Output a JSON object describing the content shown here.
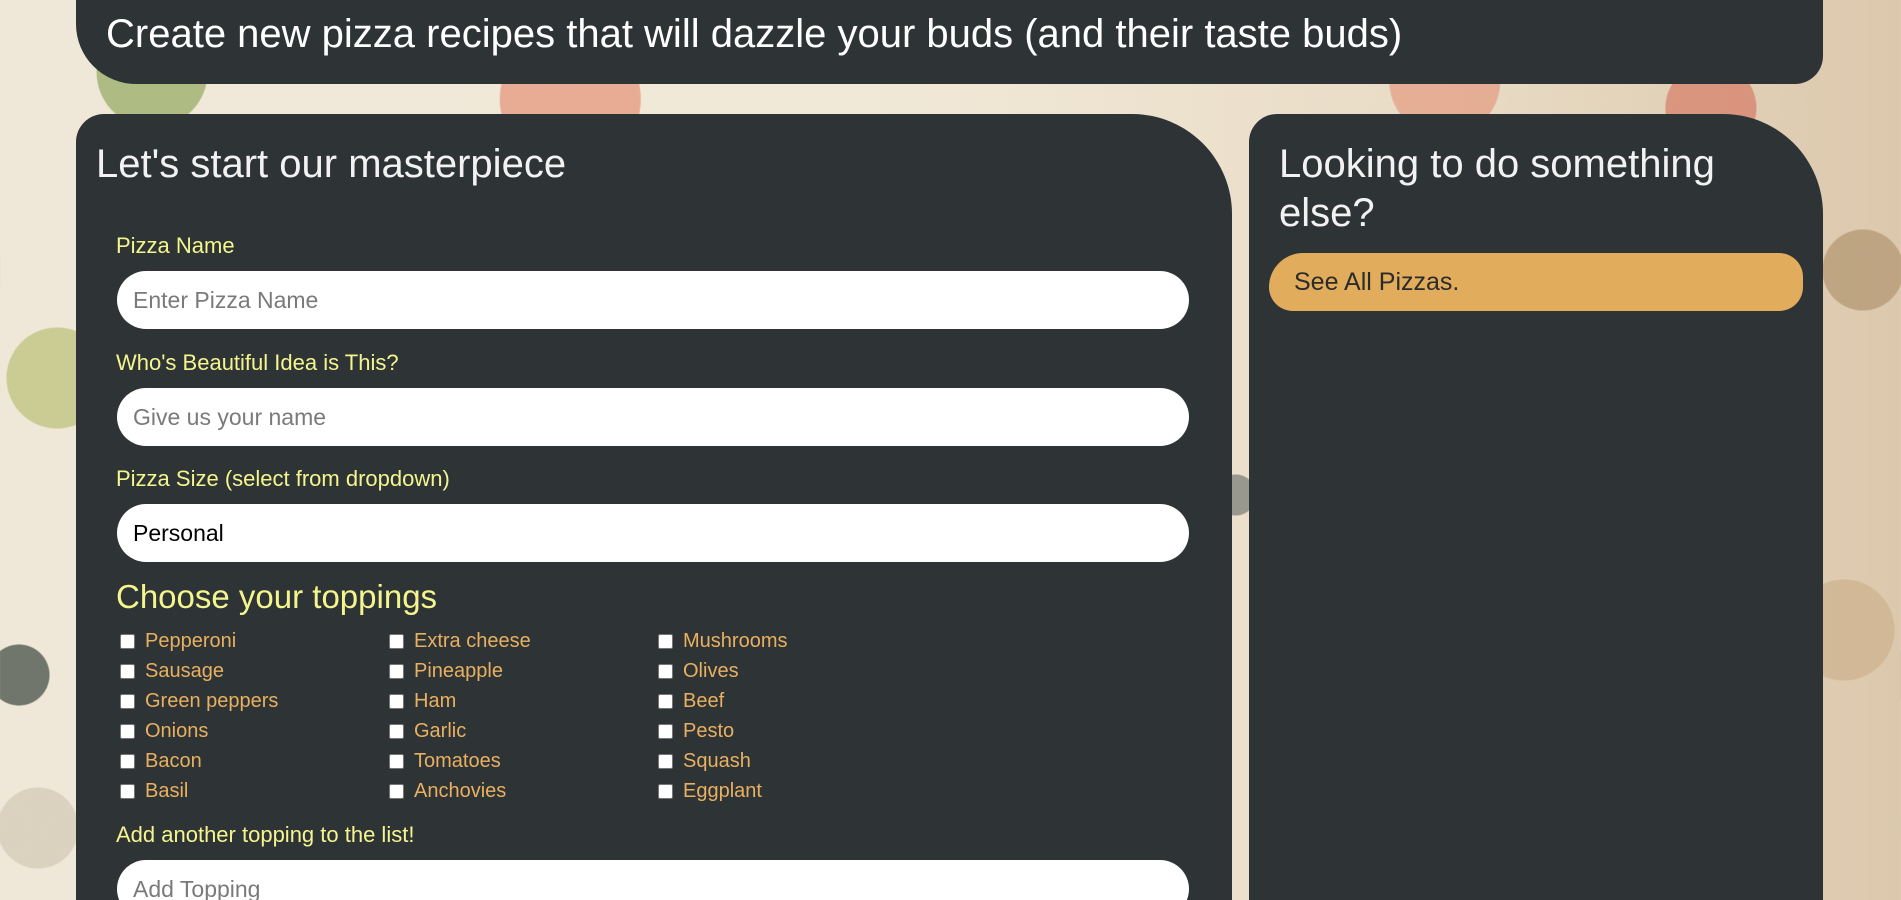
{
  "banner": {
    "text": "Create new pizza recipes that will dazzle your buds (and their taste buds)"
  },
  "form": {
    "title": "Let's start our masterpiece",
    "pizza_name": {
      "label": "Pizza Name",
      "placeholder": "Enter Pizza Name",
      "value": ""
    },
    "creator": {
      "label": "Who's Beautiful Idea is This?",
      "placeholder": "Give us your name",
      "value": ""
    },
    "size": {
      "label": "Pizza Size (select from dropdown)",
      "selected": "Personal"
    },
    "toppings": {
      "title": "Choose your toppings",
      "columns": [
        [
          "Pepperoni",
          "Sausage",
          "Green peppers",
          "Onions",
          "Bacon",
          "Basil"
        ],
        [
          "Extra cheese",
          "Pineapple",
          "Ham",
          "Garlic",
          "Tomatoes",
          "Anchovies"
        ],
        [
          "Mushrooms",
          "Olives",
          "Beef",
          "Pesto",
          "Squash",
          "Eggplant"
        ]
      ]
    },
    "add_topping": {
      "label": "Add another topping to the list!",
      "placeholder": "Add Topping",
      "value": ""
    }
  },
  "sidebar": {
    "title": "Looking to do something else?",
    "all_pizzas_label": "See All Pizzas."
  },
  "colors": {
    "card_bg": "#2e3336",
    "label_yellow": "#f5f58e",
    "topping_orange": "#e8b060",
    "button_gold": "#e1ad5c"
  }
}
